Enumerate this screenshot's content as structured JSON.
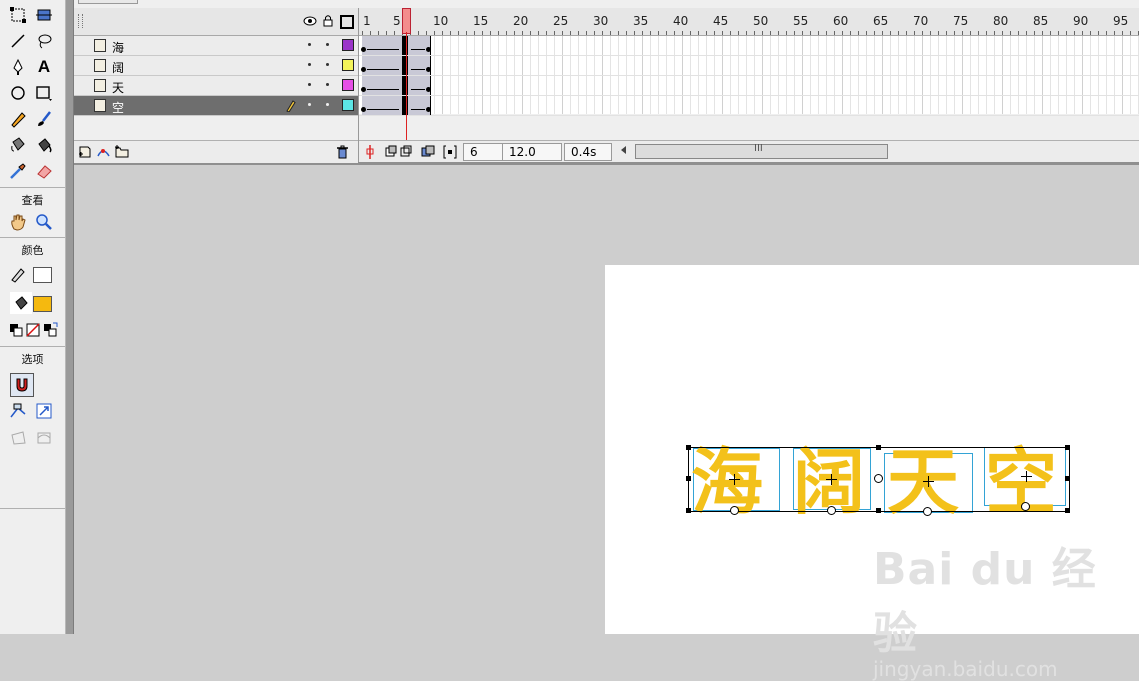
{
  "tools": {
    "sections": [
      {
        "label": "查看"
      },
      {
        "label": "颜色"
      },
      {
        "label": "选项"
      }
    ],
    "text_tool_glyph": "A",
    "stroke_color": "#ffffff",
    "fill_color": "#f5b90f"
  },
  "timeline": {
    "ruler": [
      "1",
      "5",
      "10",
      "15",
      "20",
      "25",
      "30",
      "35",
      "40",
      "45",
      "50",
      "55",
      "60",
      "65",
      "70",
      "75",
      "80",
      "85",
      "90",
      "95"
    ],
    "layers": [
      {
        "name": "海",
        "color": "#9b34c9"
      },
      {
        "name": "阔",
        "color": "#f3f35a"
      },
      {
        "name": "天",
        "color": "#e64fe6"
      },
      {
        "name": "空",
        "color": "#5ce6e6",
        "selected": true
      }
    ],
    "current_frame": "6",
    "fps": "12.0 fps",
    "elapsed": "0.4s",
    "scroll_grip": "III"
  },
  "stage": {
    "characters": [
      "海",
      "阔",
      "天",
      "空"
    ],
    "text_color": "#f3c11a",
    "watermark": {
      "main": "Bai du 经验",
      "sub": "jingyan.baidu.com"
    }
  }
}
